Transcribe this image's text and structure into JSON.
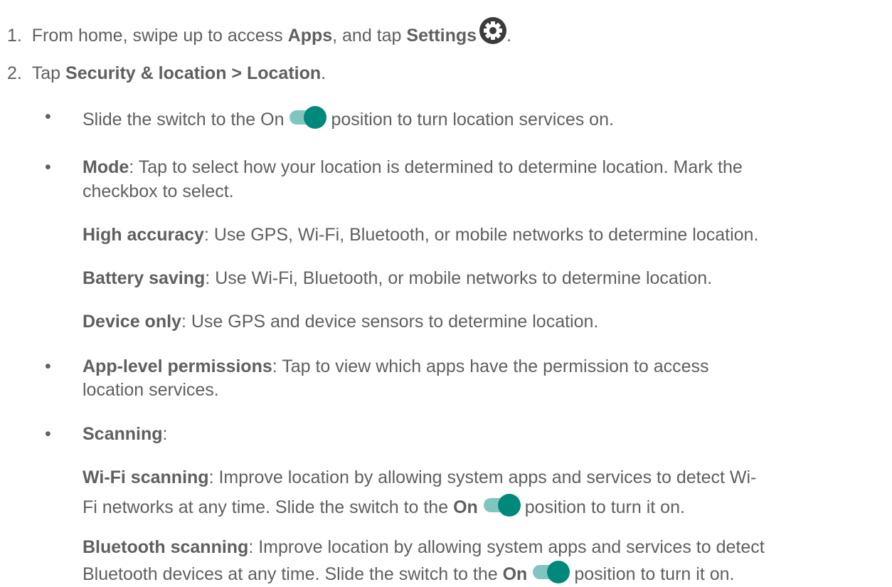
{
  "steps": [
    {
      "number": "1.",
      "pre": "From home, swipe up to access ",
      "b1": "Apps",
      "mid": ", and tap ",
      "b2": "Settings",
      "post": "."
    },
    {
      "number": "2.",
      "pre": "Tap ",
      "b1": "Security & location > Location",
      "post": "."
    }
  ],
  "bullet_symbol": "•",
  "bullets": {
    "switch": {
      "pre": "Slide the switch to the On",
      "post": "position to turn location services on."
    },
    "mode": {
      "label": "Mode",
      "text1": ": Tap to select how your location is determined to determine location. Mark the",
      "text2": "checkbox to select.",
      "options": [
        {
          "label": "High accuracy",
          "text": ": Use GPS, Wi-Fi, Bluetooth, or mobile networks to determine location."
        },
        {
          "label": "Battery saving",
          "text": ": Use Wi-Fi, Bluetooth, or mobile networks to determine location."
        },
        {
          "label": "Device only",
          "text": ": Use GPS and device sensors to determine location."
        }
      ]
    },
    "app_level": {
      "label": "App-level permissions",
      "text1": ": Tap to view which apps have the permission to access",
      "text2": "location services."
    },
    "scanning": {
      "label": "Scanning",
      "text": ":",
      "wifi": {
        "label": "Wi-Fi scanning",
        "text1": ": Improve location by allowing system apps and services to detect Wi-",
        "text2_pre": "Fi networks at any time. Slide the switch to the ",
        "on": "On",
        "text2_post": "position to turn it on."
      },
      "bluetooth": {
        "label": "Bluetooth scanning",
        "text1": ": Improve location by allowing system apps and services to detect",
        "text2_pre": "Bluetooth devices at any time. Slide the switch to the ",
        "on": "On",
        "text2_post": "position to turn it on."
      }
    }
  },
  "colors": {
    "text": "#5f5f5f",
    "toggle_track": "#7fc6c0",
    "toggle_knob": "#00897b",
    "gear_bg": "#3b3b3b"
  },
  "icons": [
    "settings-gear-icon",
    "toggle-on-icon"
  ]
}
